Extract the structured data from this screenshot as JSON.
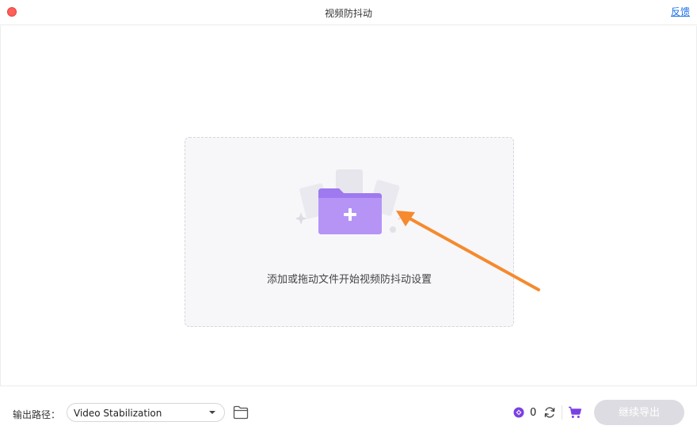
{
  "window": {
    "title": "视频防抖动",
    "feedback_label": "反馈"
  },
  "dropzone": {
    "prompt": "添加或拖动文件开始视频防抖动设置"
  },
  "footer": {
    "path_label": "输出路径：",
    "path_value": "Video Stabilization",
    "credit_count": "0",
    "export_label": "继续导出"
  },
  "colors": {
    "accent_purple": "#9b6cf2",
    "arrow_orange": "#f58a2e",
    "feedback_blue": "#1b6ee8",
    "close_red": "#fe5f57",
    "export_disabled": "#dcdce2"
  },
  "icons": {
    "close": "close-dot-icon",
    "add_folder": "folder-plus-icon",
    "folder": "folder-icon",
    "credit": "credit-coin-icon",
    "refresh": "refresh-icon",
    "cart": "cart-icon",
    "caret": "chevron-down-icon"
  }
}
